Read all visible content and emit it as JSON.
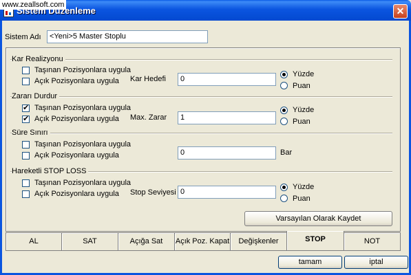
{
  "window": {
    "title": "Sistem Düzenleme",
    "watermark": "www.zeallsoft.com",
    "close_glyph": "✕"
  },
  "system_name": {
    "label": "Sistem Adı",
    "value": "<Yeni>5 Master Stoplu"
  },
  "groups": {
    "kar": {
      "title": "Kar Realizyonu",
      "cb1": "Taşınan Pozisyonlara uygula",
      "cb2": "Açık Pozisyonlara uygula",
      "cb1_checked": false,
      "cb2_checked": false,
      "field_label": "Kar Hedefi",
      "value": "0",
      "radio1": "Yüzde",
      "radio2": "Puan",
      "selected": "Yüzde"
    },
    "zarar": {
      "title": "Zararı Durdur",
      "cb1": "Taşınan Pozisyonlara uygula",
      "cb2": "Açık Pozisyonlara uygula",
      "cb1_checked": true,
      "cb2_checked": true,
      "field_label": "Max. Zarar",
      "value": "1",
      "radio1": "Yüzde",
      "radio2": "Puan",
      "selected": "Yüzde"
    },
    "sure": {
      "title": "Süre Sınırı",
      "cb1": "Taşınan Pozisyonlara uygula",
      "cb2": "Açık Pozisyonlara uygula",
      "cb1_checked": false,
      "cb2_checked": false,
      "value": "0",
      "unit": "Bar"
    },
    "stop": {
      "title": "Hareketli STOP LOSS",
      "cb1": "Taşınan Pozisyonlara uygula",
      "cb2": "Açık Pozisyonlara uygula",
      "cb1_checked": false,
      "cb2_checked": false,
      "field_label": "Stop Seviyesi",
      "value": "0",
      "radio1": "Yüzde",
      "radio2": "Puan",
      "selected": "Yüzde"
    }
  },
  "default_button": "Varsayılan Olarak Kaydet",
  "tabs": [
    {
      "label": "AL",
      "active": false
    },
    {
      "label": "SAT",
      "active": false
    },
    {
      "label": "Açığa Sat",
      "active": false
    },
    {
      "label": "Açık Poz. Kapat",
      "active": false
    },
    {
      "label": "Değişkenler",
      "active": false
    },
    {
      "label": "STOP",
      "active": true
    },
    {
      "label": "NOT",
      "active": false
    }
  ],
  "footer": {
    "ok": "tamam",
    "cancel": "iptal"
  },
  "colors": {
    "titlebar": "#0b55e0",
    "window_bg": "#ece9d8",
    "close": "#c6411d"
  }
}
